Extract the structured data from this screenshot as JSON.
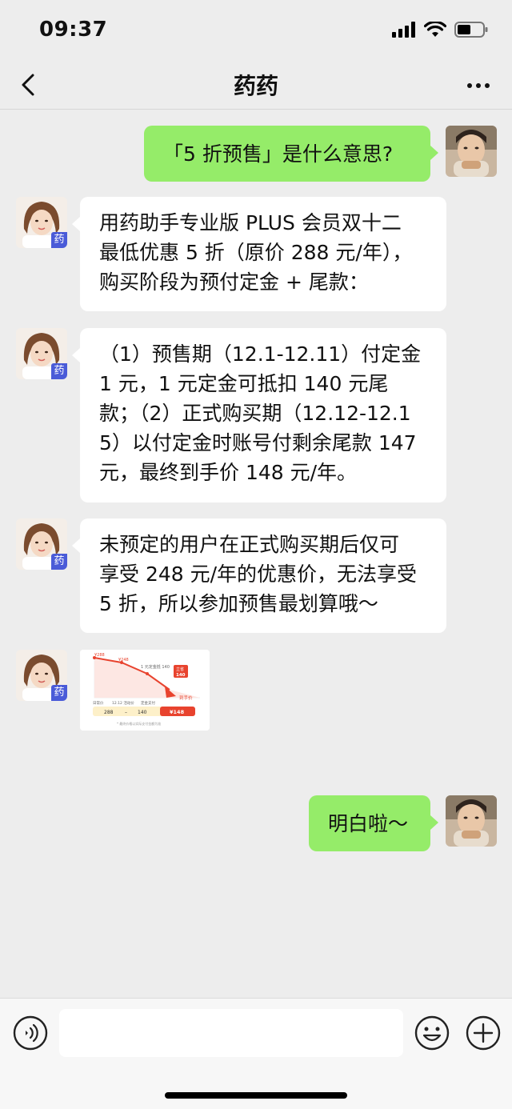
{
  "status": {
    "time": "09:37"
  },
  "nav": {
    "title": "药药"
  },
  "messages": [
    {
      "side": "out",
      "text": "「5 折预售」是什么意思?"
    },
    {
      "side": "in",
      "lines": [
        "用药助手专业版 PLUS 会员双十二",
        "最低优惠 5 折（原价 288 元/年），",
        "购买阶段为预付定金 + 尾款："
      ]
    },
    {
      "side": "in",
      "lines": [
        "（1）预售期（12.1-12.11）付定金",
        "1 元，1 元定金可抵扣 140 元尾",
        "款；（2）正式购买期（12.12-12.1",
        "5）以付定金时账号付剩余尾款 147",
        "元，最终到手价 148 元/年。"
      ]
    },
    {
      "side": "in",
      "lines": [
        "未预定的用户在正式购买期后仅可",
        "享受 248 元/年的优惠价，无法享受",
        "5 折，所以参加预售最划算哦～"
      ]
    },
    {
      "side": "out",
      "text": "明白啦～"
    }
  ],
  "avatar_badge": "药",
  "image_card": {
    "labels": [
      "¥288",
      "¥248",
      "1 元定金抵 140",
      "立省",
      "140",
      "到手价"
    ],
    "axis": [
      "日常价",
      "12.12 活动价",
      "定金支付"
    ],
    "bar": {
      "a": "288",
      "dash": "–",
      "b": "140",
      "c": "¥148"
    },
    "footnote": "* 最终价格以实际支付金额为准"
  },
  "colors": {
    "bubble_out": "#95ec69",
    "bubble_in": "#ffffff",
    "background": "#ededed",
    "accent_red": "#e8432e"
  }
}
